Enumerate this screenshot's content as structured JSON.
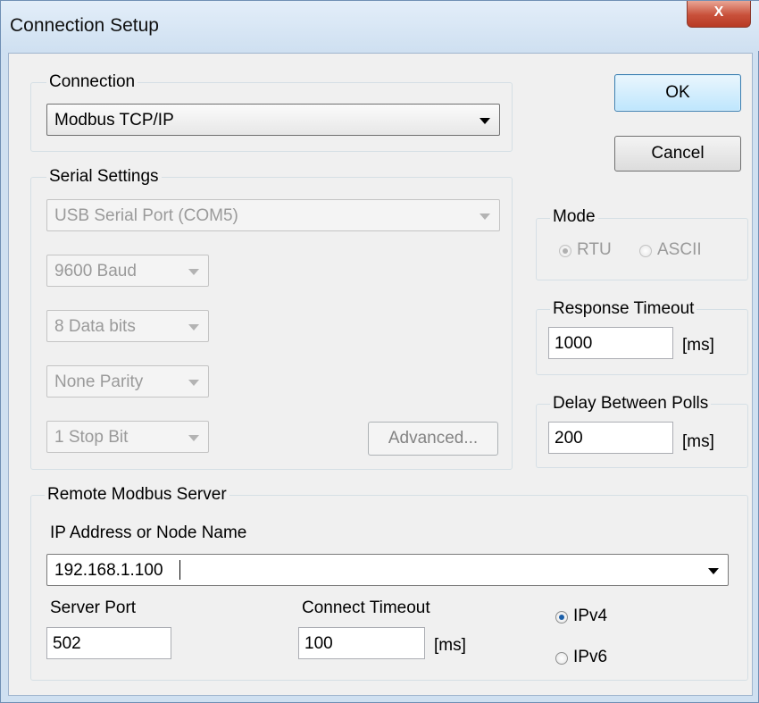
{
  "window": {
    "title": "Connection Setup",
    "close_glyph": "X"
  },
  "buttons": {
    "ok": "OK",
    "cancel": "Cancel",
    "advanced": "Advanced..."
  },
  "connection": {
    "group_label": "Connection",
    "selected": "Modbus TCP/IP"
  },
  "serial": {
    "group_label": "Serial Settings",
    "port": "USB Serial Port (COM5)",
    "baud": "9600 Baud",
    "data_bits": "8 Data bits",
    "parity": "None Parity",
    "stop_bits": "1 Stop Bit"
  },
  "mode": {
    "group_label": "Mode",
    "rtu": "RTU",
    "ascii": "ASCII",
    "selected": "RTU"
  },
  "response_timeout": {
    "group_label": "Response Timeout",
    "value": "1000",
    "unit": "[ms]"
  },
  "delay_polls": {
    "group_label": "Delay Between Polls",
    "value": "200",
    "unit": "[ms]"
  },
  "remote": {
    "group_label": "Remote Modbus Server",
    "ip_label": "IP Address or Node Name",
    "ip_value": "192.168.1.100",
    "port_label": "Server Port",
    "port_value": "502",
    "timeout_label": "Connect Timeout",
    "timeout_value": "100",
    "timeout_unit": "[ms]",
    "ipv4": "IPv4",
    "ipv6": "IPv6",
    "ip_version_selected": "IPv4"
  },
  "icons": {
    "close": "close-icon",
    "dropdown": "chevron-down-icon"
  }
}
